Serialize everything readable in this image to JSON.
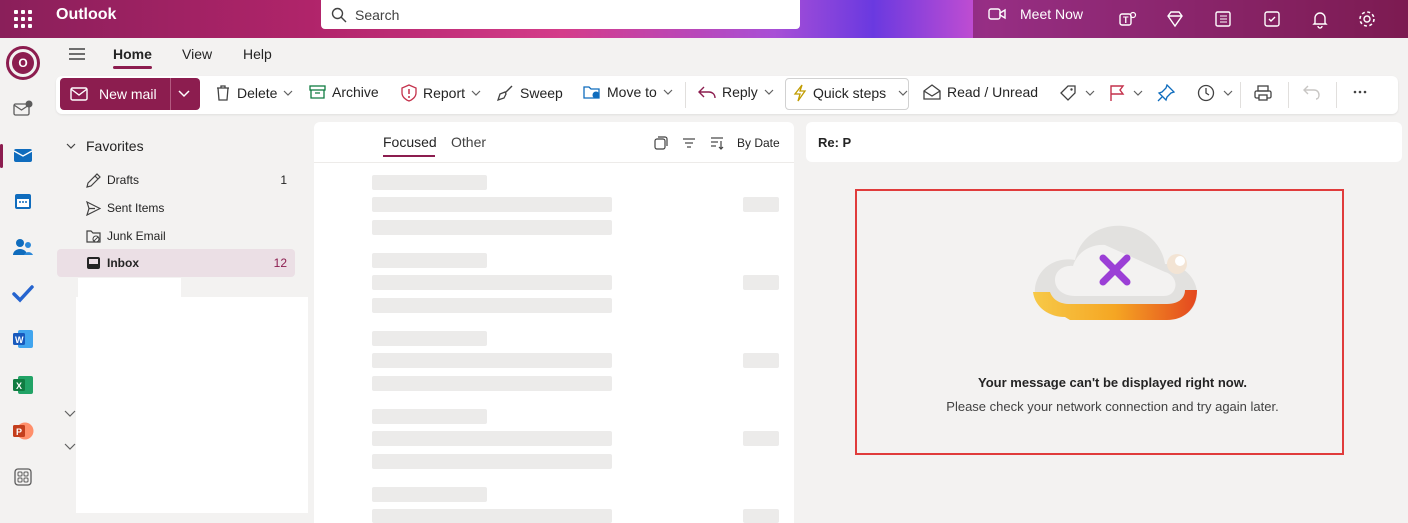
{
  "titlebar": {
    "app_name": "Outlook",
    "search_placeholder": "Search",
    "meet_now": "Meet Now"
  },
  "tabs": {
    "home": "Home",
    "view": "View",
    "help": "Help"
  },
  "ribbon": {
    "new_mail": "New mail",
    "delete": "Delete",
    "archive": "Archive",
    "report": "Report",
    "sweep": "Sweep",
    "move_to": "Move to",
    "reply": "Reply",
    "quick_steps": "Quick steps",
    "read_unread": "Read / Unread"
  },
  "folders": {
    "favorites": "Favorites",
    "items": [
      {
        "name": "Drafts",
        "count": "1"
      },
      {
        "name": "Sent Items",
        "count": ""
      },
      {
        "name": "Junk Email",
        "count": ""
      },
      {
        "name": "Inbox",
        "count": "12"
      }
    ]
  },
  "message_list": {
    "focused": "Focused",
    "other": "Other",
    "sort": "By Date"
  },
  "reading_pane": {
    "subject": "Re: P",
    "error_title": "Your message can't be displayed right now.",
    "error_subtitle": "Please check your network connection and try again later."
  },
  "colors": {
    "accent": "#8c1d4f",
    "error_border": "#e03c3c"
  }
}
